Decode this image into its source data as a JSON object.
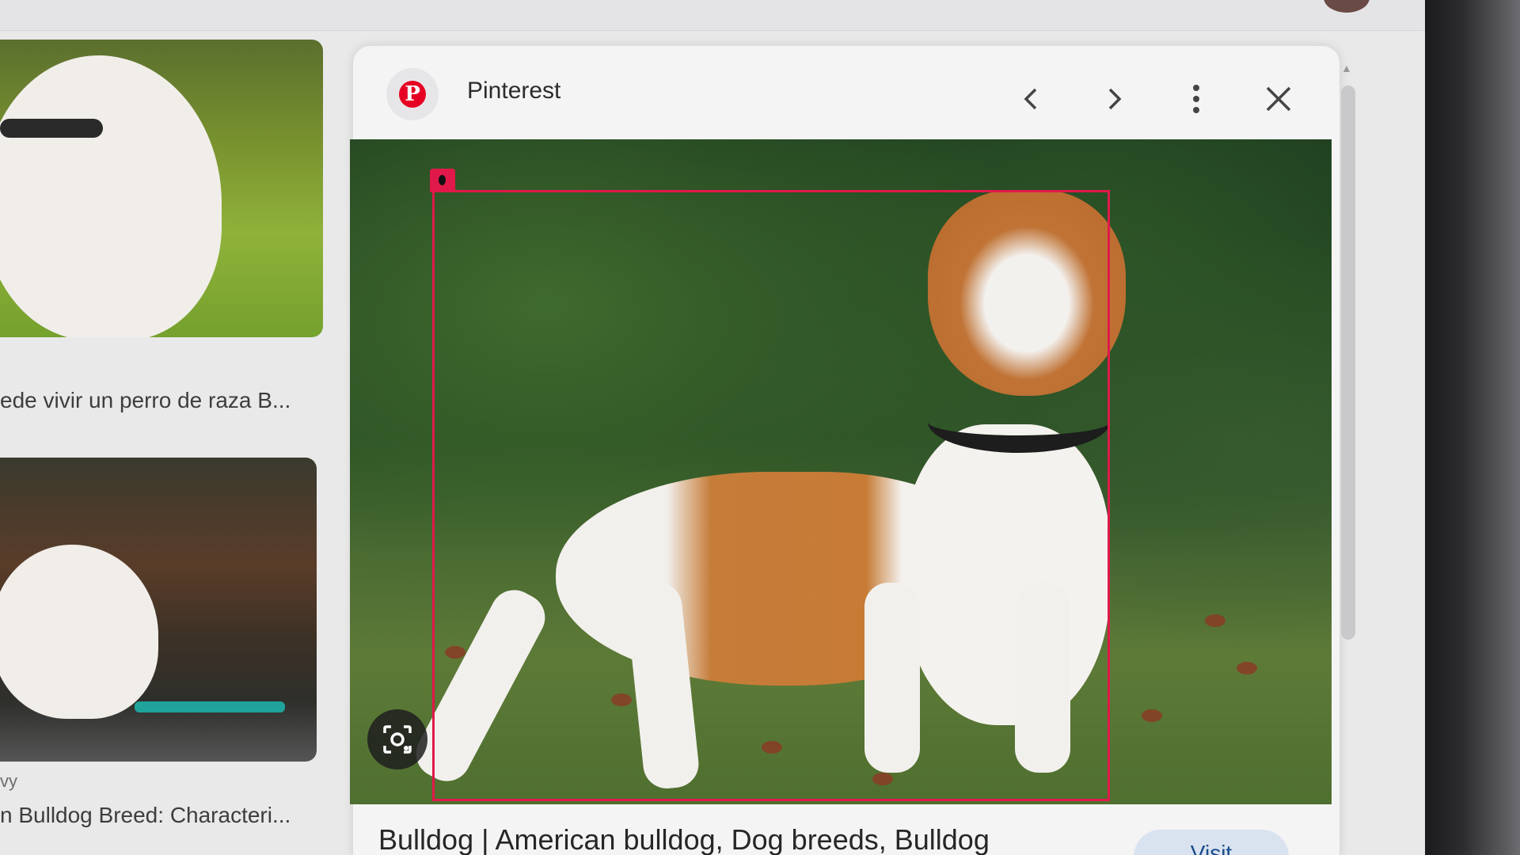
{
  "results": {
    "items": [
      {
        "caption": "ede vivir un perro de raza B..."
      },
      {
        "source": "vy",
        "caption": "n Bulldog Breed: Characteri..."
      }
    ]
  },
  "preview": {
    "site_name": "Pinterest",
    "site_icon": "pinterest-logo",
    "site_logo_letter": "P",
    "title": "Bulldog | American bulldog, Dog breeds, Bulldog",
    "visit_label": "Visit",
    "controls": [
      "previous-arrow",
      "next-arrow",
      "more-vertical",
      "close"
    ],
    "accent_color": "#e0194a",
    "lens_icon": "visual-search-icon"
  }
}
